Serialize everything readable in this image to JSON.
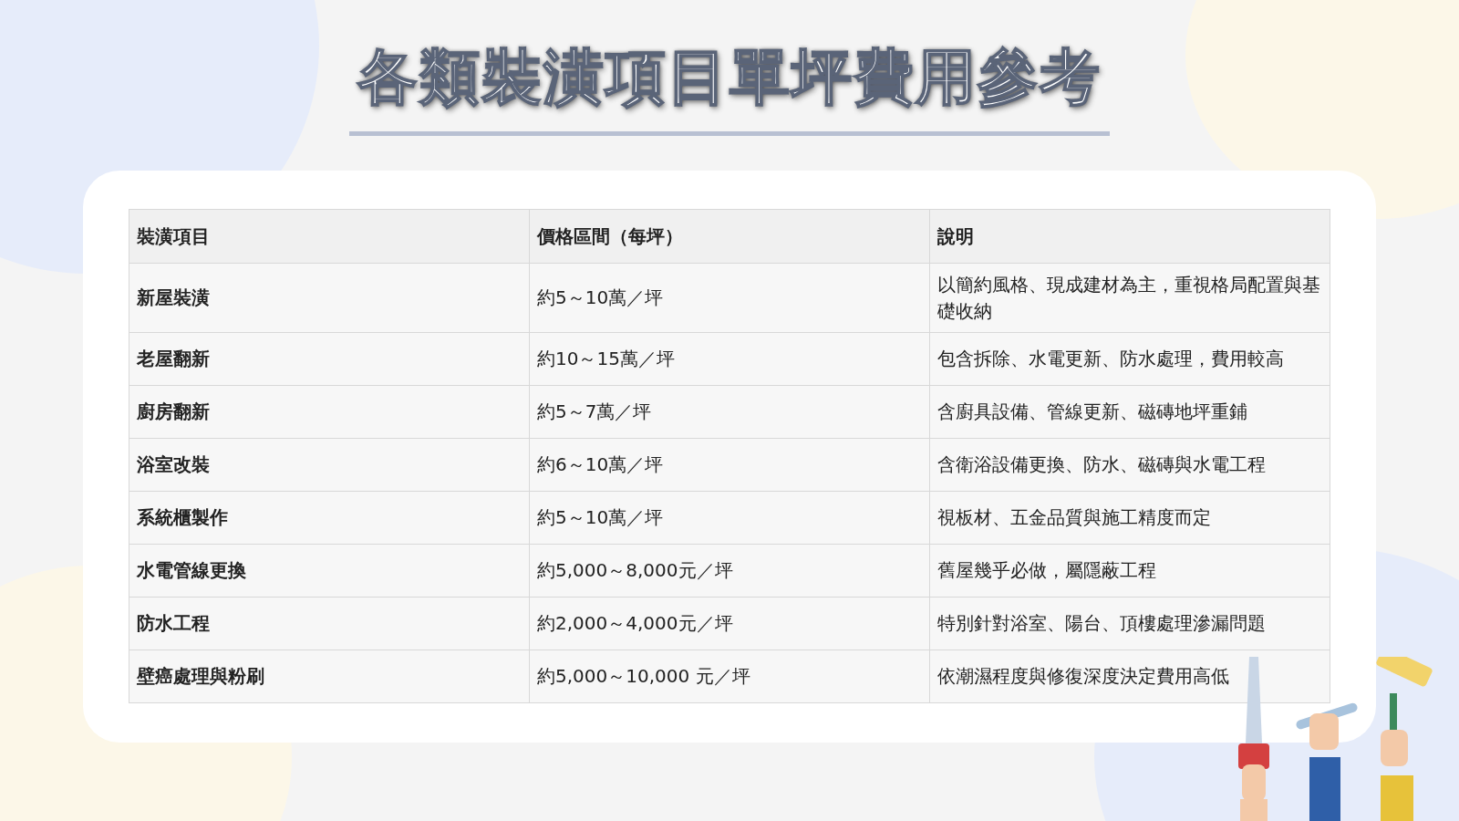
{
  "title": "各類裝潢項目單坪費用參考",
  "table": {
    "columns": [
      "裝潢項目",
      "價格區間（每坪）",
      "說明"
    ],
    "rows": [
      [
        "新屋裝潢",
        "約5～10萬／坪",
        "以簡約風格、現成建材為主，重視格局配置與基礎收納"
      ],
      [
        "老屋翻新",
        "約10～15萬／坪",
        "包含拆除、水電更新、防水處理，費用較高"
      ],
      [
        "廚房翻新",
        "約5～7萬／坪",
        "含廚具設備、管線更新、磁磚地坪重鋪"
      ],
      [
        "浴室改裝",
        "約6～10萬／坪",
        "含衛浴設備更換、防水、磁磚與水電工程"
      ],
      [
        "系統櫃製作",
        "約5～10萬／坪",
        "視板材、五金品質與施工精度而定"
      ],
      [
        "水電管線更換",
        "約5,000～8,000元／坪",
        "舊屋幾乎必做，屬隱蔽工程"
      ],
      [
        "防水工程",
        "約2,000～4,000元／坪",
        "特別針對浴室、陽台、頂樓處理滲漏問題"
      ],
      [
        "壁癌處理與粉刷",
        "約5,000～10,000 元／坪",
        "依潮濕程度與修復深度決定費用高低"
      ]
    ]
  }
}
